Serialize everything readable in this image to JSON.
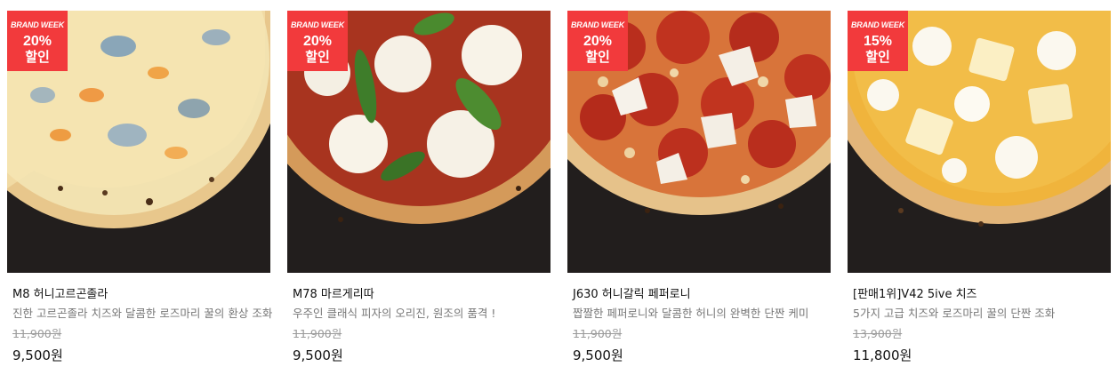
{
  "products": [
    {
      "badge": {
        "label": "BRAND WEEK",
        "percent": "20%",
        "discount": "할인"
      },
      "name": "M8 허니고르곤졸라",
      "description": "진한 고르곤졸라 치즈와 달콤한 로즈마리 꿀의 환상 조화",
      "original_price": "11,900원",
      "price": "9,500원"
    },
    {
      "badge": {
        "label": "BRAND WEEK",
        "percent": "20%",
        "discount": "할인"
      },
      "name": "M78 마르게리따",
      "description": "우주인 클래식 피자의 오리진, 원조의 품격 !",
      "original_price": "11,900원",
      "price": "9,500원"
    },
    {
      "badge": {
        "label": "BRAND WEEK",
        "percent": "20%",
        "discount": "할인"
      },
      "name": "J630 허니갈릭 페퍼로니",
      "description": "짭짤한 페퍼로니와 달콤한 허니의 완벽한 단짠 케미",
      "original_price": "11,900원",
      "price": "9,500원"
    },
    {
      "badge": {
        "label": "BRAND WEEK",
        "percent": "15%",
        "discount": "할인"
      },
      "name": "[판매1위]V42 5ive 치즈",
      "description": "5가지 고급 치즈와 로즈마리 꿀의 단짠 조화",
      "original_price": "13,900원",
      "price": "11,800원"
    }
  ],
  "colors": {
    "badge": "#f23a3c",
    "background_dark": "#1f1c1b"
  }
}
